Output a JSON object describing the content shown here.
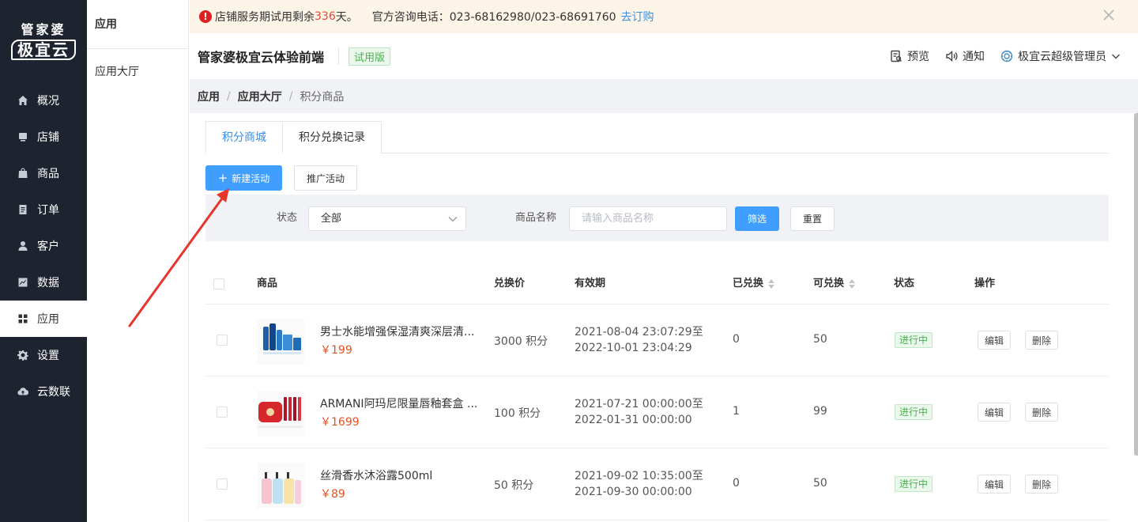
{
  "sidebar": {
    "logo_top": "管家婆",
    "logo_bottom": "极宜云",
    "items": [
      {
        "label": "概况",
        "icon": "home-icon"
      },
      {
        "label": "店铺",
        "icon": "store-icon"
      },
      {
        "label": "商品",
        "icon": "goods-icon"
      },
      {
        "label": "订单",
        "icon": "order-icon"
      },
      {
        "label": "客户",
        "icon": "customer-icon"
      },
      {
        "label": "数据",
        "icon": "chart-icon"
      },
      {
        "label": "应用",
        "icon": "grid-icon",
        "active": true
      },
      {
        "label": "设置",
        "icon": "gear-icon"
      },
      {
        "label": "云数联",
        "icon": "cloud-icon"
      }
    ]
  },
  "submenu": {
    "title": "应用",
    "items": [
      "应用大厅"
    ]
  },
  "notice": {
    "prefix": "店铺服务期试用剩余",
    "days": "336",
    "suffix": "天。",
    "phone": "官方咨询电话：023-68162980/023-68691760",
    "link": "去订购"
  },
  "header": {
    "brand": "管家婆极宜云体验前端",
    "badge": "试用版",
    "preview": "预览",
    "notify": "通知",
    "user": "极宜云超级管理员"
  },
  "breadcrumb": {
    "a": "应用",
    "b": "应用大厅",
    "c": "积分商品",
    "sep": "/"
  },
  "tabs": [
    "积分商城",
    "积分兑换记录"
  ],
  "actions": {
    "new_label": "新建活动",
    "promo_label": "推广活动"
  },
  "filter": {
    "status_label": "状态",
    "status_value": "全部",
    "name_label": "商品名称",
    "name_placeholder": "请输入商品名称",
    "filter_btn": "筛选",
    "reset_btn": "重置"
  },
  "table": {
    "columns": {
      "product": "商品",
      "price": "兑换价",
      "validity": "有效期",
      "redeemed": "已兑换",
      "available": "可兑换",
      "status": "状态",
      "ops": "操作"
    },
    "rows": [
      {
        "name": "男士水能增强保湿清爽深层清...",
        "price": "￥199",
        "points": "3000 积分",
        "from": "2021-08-04 23:07:29至",
        "to": "2022-10-01 23:04:29",
        "redeemed": "0",
        "available": "50",
        "status": "进行中",
        "edit": "编辑",
        "del": "删除"
      },
      {
        "name": "ARMANI阿玛尼限量唇釉套盒 ...",
        "price": "￥1699",
        "points": "100 积分",
        "from": "2021-07-21 00:00:00至",
        "to": "2022-01-31 00:00:00",
        "redeemed": "1",
        "available": "99",
        "status": "进行中",
        "edit": "编辑",
        "del": "删除"
      },
      {
        "name": "丝滑香水沐浴露500ml",
        "price": "￥89",
        "points": "50 积分",
        "from": "2021-09-02 10:35:00至",
        "to": "2021-09-30 00:00:00",
        "redeemed": "0",
        "available": "50",
        "status": "进行中",
        "edit": "编辑",
        "del": "删除"
      }
    ]
  },
  "colors": {
    "sidebar_bg": "#1e2330",
    "primary": "#409eff",
    "price": "#e8501e",
    "status_green": "#4caf50",
    "annotation_arrow": "#e8352b"
  }
}
